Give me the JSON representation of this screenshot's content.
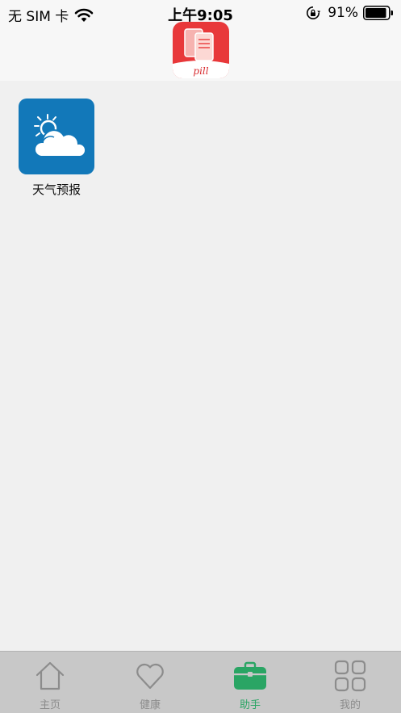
{
  "status_bar": {
    "carrier": "无 SIM 卡",
    "time": "上午9:05",
    "battery": "91%"
  },
  "header": {
    "logo_icon": "pill-app-logo-icon",
    "logo_text": "pill"
  },
  "main": {
    "tiles": [
      {
        "label": "天气预报",
        "icon": "weather-cloud-sun-icon",
        "color": "#1278b9"
      }
    ]
  },
  "tabbar": {
    "tabs": [
      {
        "label": "主页",
        "icon": "home-icon",
        "active": false
      },
      {
        "label": "健康",
        "icon": "heart-icon",
        "active": false
      },
      {
        "label": "助手",
        "icon": "briefcase-icon",
        "active": true
      },
      {
        "label": "我的",
        "icon": "grid-icon",
        "active": false
      }
    ],
    "active_color": "#2aa564",
    "inactive_color": "#8c8c8c"
  }
}
